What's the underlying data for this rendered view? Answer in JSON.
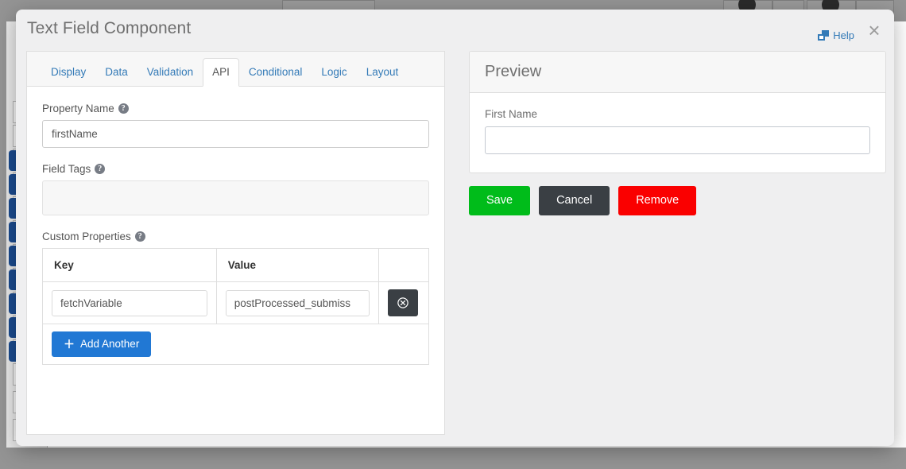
{
  "modal": {
    "title": "Text Field Component",
    "help_label": "Help",
    "help_icon": "clone-icon",
    "close_icon": "close-icon",
    "close_glyph": "×"
  },
  "tabs": [
    {
      "label": "Display",
      "active": false
    },
    {
      "label": "Data",
      "active": false
    },
    {
      "label": "Validation",
      "active": false
    },
    {
      "label": "API",
      "active": true
    },
    {
      "label": "Conditional",
      "active": false
    },
    {
      "label": "Logic",
      "active": false
    },
    {
      "label": "Layout",
      "active": false
    }
  ],
  "api_tab": {
    "property_name": {
      "label": "Property Name",
      "help_icon": "question-circle-icon",
      "help_glyph": "?",
      "value": "firstName",
      "placeholder": ""
    },
    "field_tags": {
      "label": "Field Tags",
      "help_icon": "question-circle-icon",
      "help_glyph": "?",
      "value": "",
      "placeholder": ""
    },
    "custom_properties": {
      "label": "Custom Properties",
      "help_icon": "question-circle-icon",
      "help_glyph": "?",
      "columns": [
        "Key",
        "Value",
        ""
      ],
      "rows": [
        {
          "key": "fetchVariable",
          "value": "postProcessed_submiss",
          "remove_icon": "times-circle-icon",
          "remove_glyph": "⊗"
        }
      ],
      "add_button": {
        "label": "Add Another",
        "icon": "plus-icon",
        "glyph": "＋"
      }
    }
  },
  "preview": {
    "title": "Preview",
    "field_label": "First Name",
    "field_value": "",
    "field_placeholder": ""
  },
  "actions": {
    "save": "Save",
    "cancel": "Cancel",
    "remove": "Remove"
  },
  "colors": {
    "accent_blue": "#337ab7",
    "add_button_blue": "#2178d4",
    "save_green": "#00bc1a",
    "cancel_dark": "#3a3f44",
    "remove_red": "#fa0000",
    "modal_bg": "#efeff0",
    "backdrop_grey": "#949494",
    "sidebar_chip_blue": "#1b4b8f"
  }
}
